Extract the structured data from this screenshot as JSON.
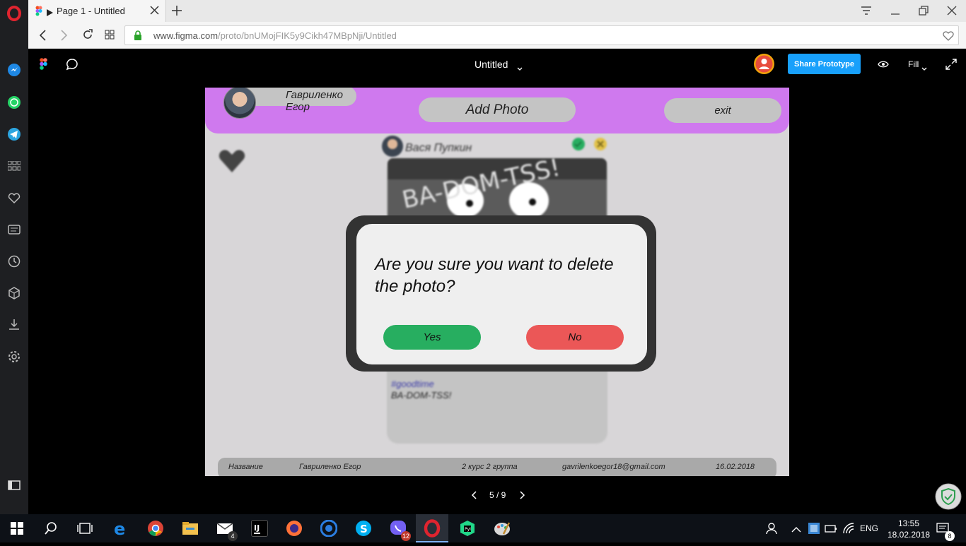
{
  "browser": {
    "tab_title": "Page 1 - Untitled",
    "url_host": "www.figma.com",
    "url_path": "/proto/bnUMojFIK5y9Cikh47MBpNji/Untitled"
  },
  "figma": {
    "doc_title": "Untitled",
    "share_label": "Share Prototype",
    "fill_label": "Fill"
  },
  "app": {
    "user_name": "Гавриленко Егор",
    "add_photo_label": "Add Photo",
    "exit_label": "exit",
    "post": {
      "author": "Вася Пупкин",
      "image_text": "BA-DOM-TSS!",
      "tag": "#goodtime",
      "caption": "BA-DOM-TSS!"
    },
    "footer": {
      "name_label": "Название",
      "author": "Гавриленко Егор",
      "group": "2 курс 2 группа",
      "email": "gavrilenkoegor18@gmail.com",
      "date": "16.02.2018"
    },
    "modal": {
      "question": "Are you sure you want to delete the photo?",
      "yes_label": "Yes",
      "no_label": "No"
    }
  },
  "pager": {
    "counter": "5 / 9"
  },
  "taskbar": {
    "mail_badge": "4",
    "viber_badge": "12",
    "lang": "ENG",
    "time": "13:55",
    "date": "18.02.2018",
    "notif_count": "8"
  },
  "colors": {
    "header": "#cf79ee",
    "yes": "#27ae60",
    "no": "#eb5757",
    "share": "#18a0fb"
  }
}
